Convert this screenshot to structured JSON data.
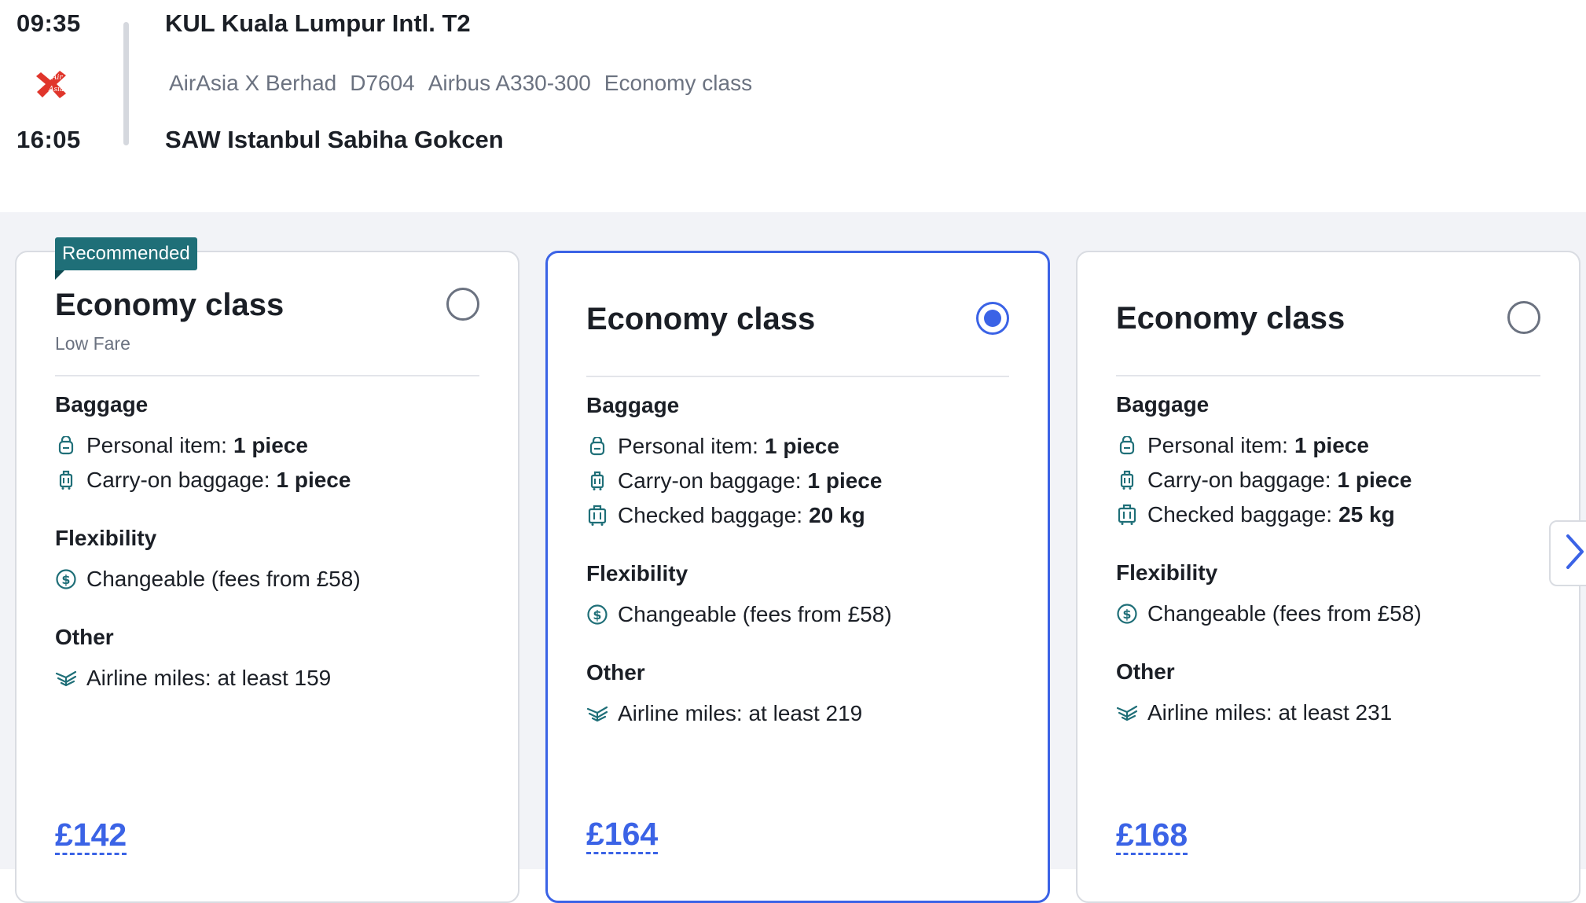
{
  "flight": {
    "departure_time": "09:35",
    "arrival_time": "16:05",
    "departure_airport": "KUL Kuala Lumpur Intl. T2",
    "arrival_airport": "SAW Istanbul Sabiha Gokcen",
    "airline": "AirAsia X Berhad",
    "flight_number": "D7604",
    "aircraft": "Airbus A330-300",
    "cabin": "Economy class",
    "airline_logo_icon": "airasia-logo-icon"
  },
  "labels": {
    "baggage": "Baggage",
    "flexibility": "Flexibility",
    "other": "Other"
  },
  "fares": [
    {
      "badge": "Recommended",
      "title": "Economy class",
      "fare_name": "Low Fare",
      "selected": false,
      "personal_item_label": "Personal item:",
      "personal_item_value": "1 piece",
      "carry_on_label": "Carry-on baggage:",
      "carry_on_value": "1 piece",
      "flexibility": "Changeable (fees from £58)",
      "miles": "Airline miles: at least 159",
      "price": "£142"
    },
    {
      "title": "Economy class",
      "selected": true,
      "personal_item_label": "Personal item:",
      "personal_item_value": "1 piece",
      "carry_on_label": "Carry-on baggage:",
      "carry_on_value": "1 piece",
      "checked_label": "Checked baggage:",
      "checked_value": "20 kg",
      "flexibility": "Changeable (fees from £58)",
      "miles": "Airline miles: at least 219",
      "price": "£164"
    },
    {
      "title": "Economy class",
      "selected": false,
      "personal_item_label": "Personal item:",
      "personal_item_value": "1 piece",
      "carry_on_label": "Carry-on baggage:",
      "carry_on_value": "1 piece",
      "checked_label": "Checked baggage:",
      "checked_value": "25 kg",
      "flexibility": "Changeable (fees from £58)",
      "miles": "Airline miles: at least 231",
      "price": "£168"
    }
  ],
  "colors": {
    "accent": "#3b63e6",
    "badge": "#1f6f78",
    "icon": "#1f6f78",
    "background": "#f2f3f7"
  },
  "icons": {
    "personal_item": "backpack-icon",
    "carry_on": "carry-on-bag-icon",
    "checked": "suitcase-icon",
    "flexibility": "dollar-circle-icon",
    "miles": "airline-miles-icon",
    "next": "chevron-right-icon"
  }
}
